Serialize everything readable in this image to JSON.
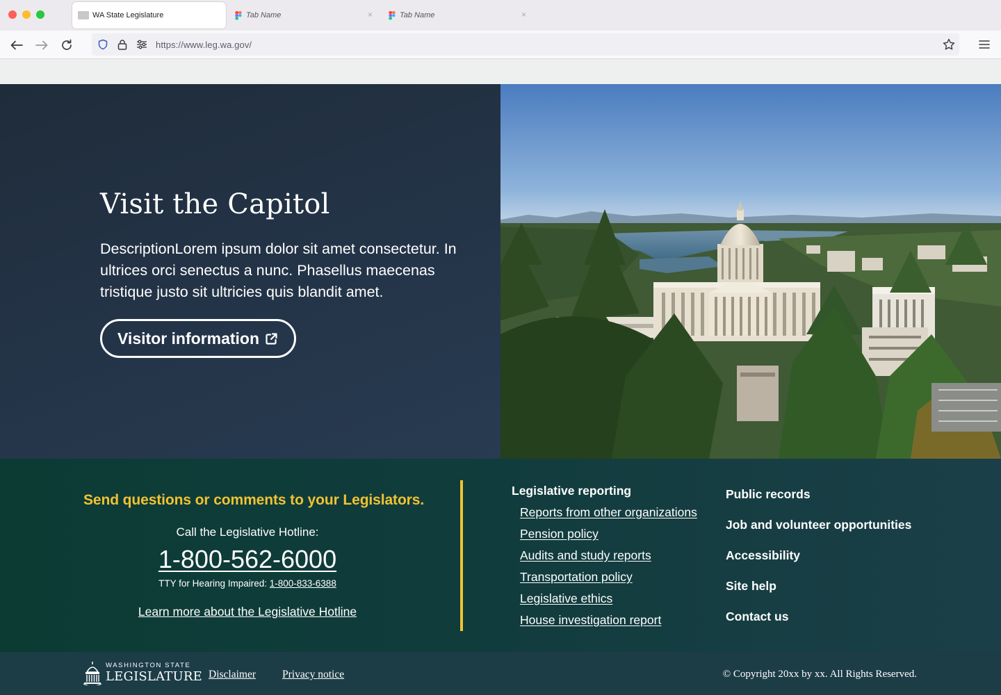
{
  "browser": {
    "tabs": [
      {
        "label": "WA State Legislature",
        "active": true
      },
      {
        "label": "Tab Name",
        "active": false
      },
      {
        "label": "Tab Name",
        "active": false
      }
    ],
    "tab_close_glyph": "×",
    "url": "https://www.leg.wa.gov/"
  },
  "hero": {
    "title": "Visit the Capitol",
    "description": "DescriptionLorem ipsum dolor sit amet consectetur. In ultrices orci senectus a nunc. Phasellus maecenas tristique justo sit ultricies quis blandit amet.",
    "button_label": "Visitor information"
  },
  "footer": {
    "send_questions": "Send questions or comments to your Legislators.",
    "hotline_label": "Call the Legislative Hotline:",
    "hotline_number": "1-800-562-6000",
    "tty_label": "TTY for Hearing Impaired:",
    "tty_number": "1-800-833-6388",
    "learn_more": "Learn more about the Legislative Hotline",
    "legislative_reporting": {
      "title": "Legislative reporting",
      "links": [
        "Reports from other organizations",
        "Pension policy",
        "Audits and study reports",
        "Transportation policy",
        "Legislative ethics",
        "House investigation report"
      ]
    },
    "right_links": [
      "Public records",
      "Job and volunteer opportunities",
      "Accessibility",
      "Site help",
      "Contact us"
    ]
  },
  "bottom": {
    "logo_top": "WASHINGTON STATE",
    "logo_main": "LEGISLATURE",
    "disclaimer": "Disclaimer",
    "privacy": "Privacy notice",
    "copyright": "© Copyright 20xx by xx. All Rights Reserved."
  },
  "colors": {
    "accent_yellow": "#f1c232",
    "hero_bg": "#243448",
    "footer_bg": "#103c3c",
    "bottombar_bg": "#1c3c46"
  }
}
